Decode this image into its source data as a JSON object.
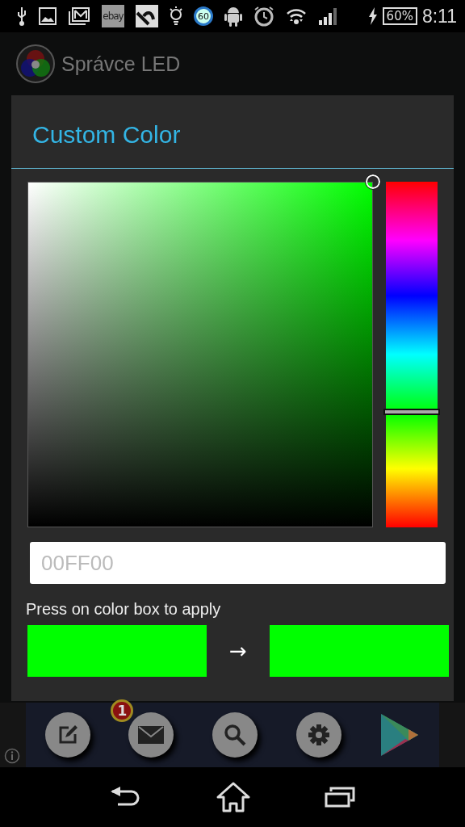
{
  "status_bar": {
    "battery": "60%",
    "time": "8:11",
    "icons": [
      {
        "kind": "usb"
      },
      {
        "kind": "image"
      },
      {
        "kind": "mail"
      },
      {
        "kind": "ebay",
        "label": "ebay"
      },
      {
        "kind": "tile"
      },
      {
        "kind": "bulb"
      },
      {
        "kind": "badge",
        "label": "60"
      },
      {
        "kind": "android"
      },
      {
        "kind": "alarm"
      },
      {
        "kind": "wifi"
      },
      {
        "kind": "signal"
      }
    ]
  },
  "app_bar": {
    "title": "Správce LED"
  },
  "dialog": {
    "title": "Custom Color",
    "hex_field": {
      "placeholder": "00FF00"
    },
    "hint": "Press on color box to apply",
    "swatches": [
      {
        "color": "#00ff00"
      },
      {
        "color": "#00ff00"
      }
    ],
    "arrow": "→"
  },
  "ad_bar": {
    "buttons": [
      {
        "kind": "edit"
      },
      {
        "kind": "mail",
        "badge": "1"
      },
      {
        "kind": "search"
      },
      {
        "kind": "settings"
      }
    ]
  },
  "nav_bar": {
    "buttons": [
      {
        "kind": "back"
      },
      {
        "kind": "home"
      },
      {
        "kind": "recents"
      }
    ]
  }
}
